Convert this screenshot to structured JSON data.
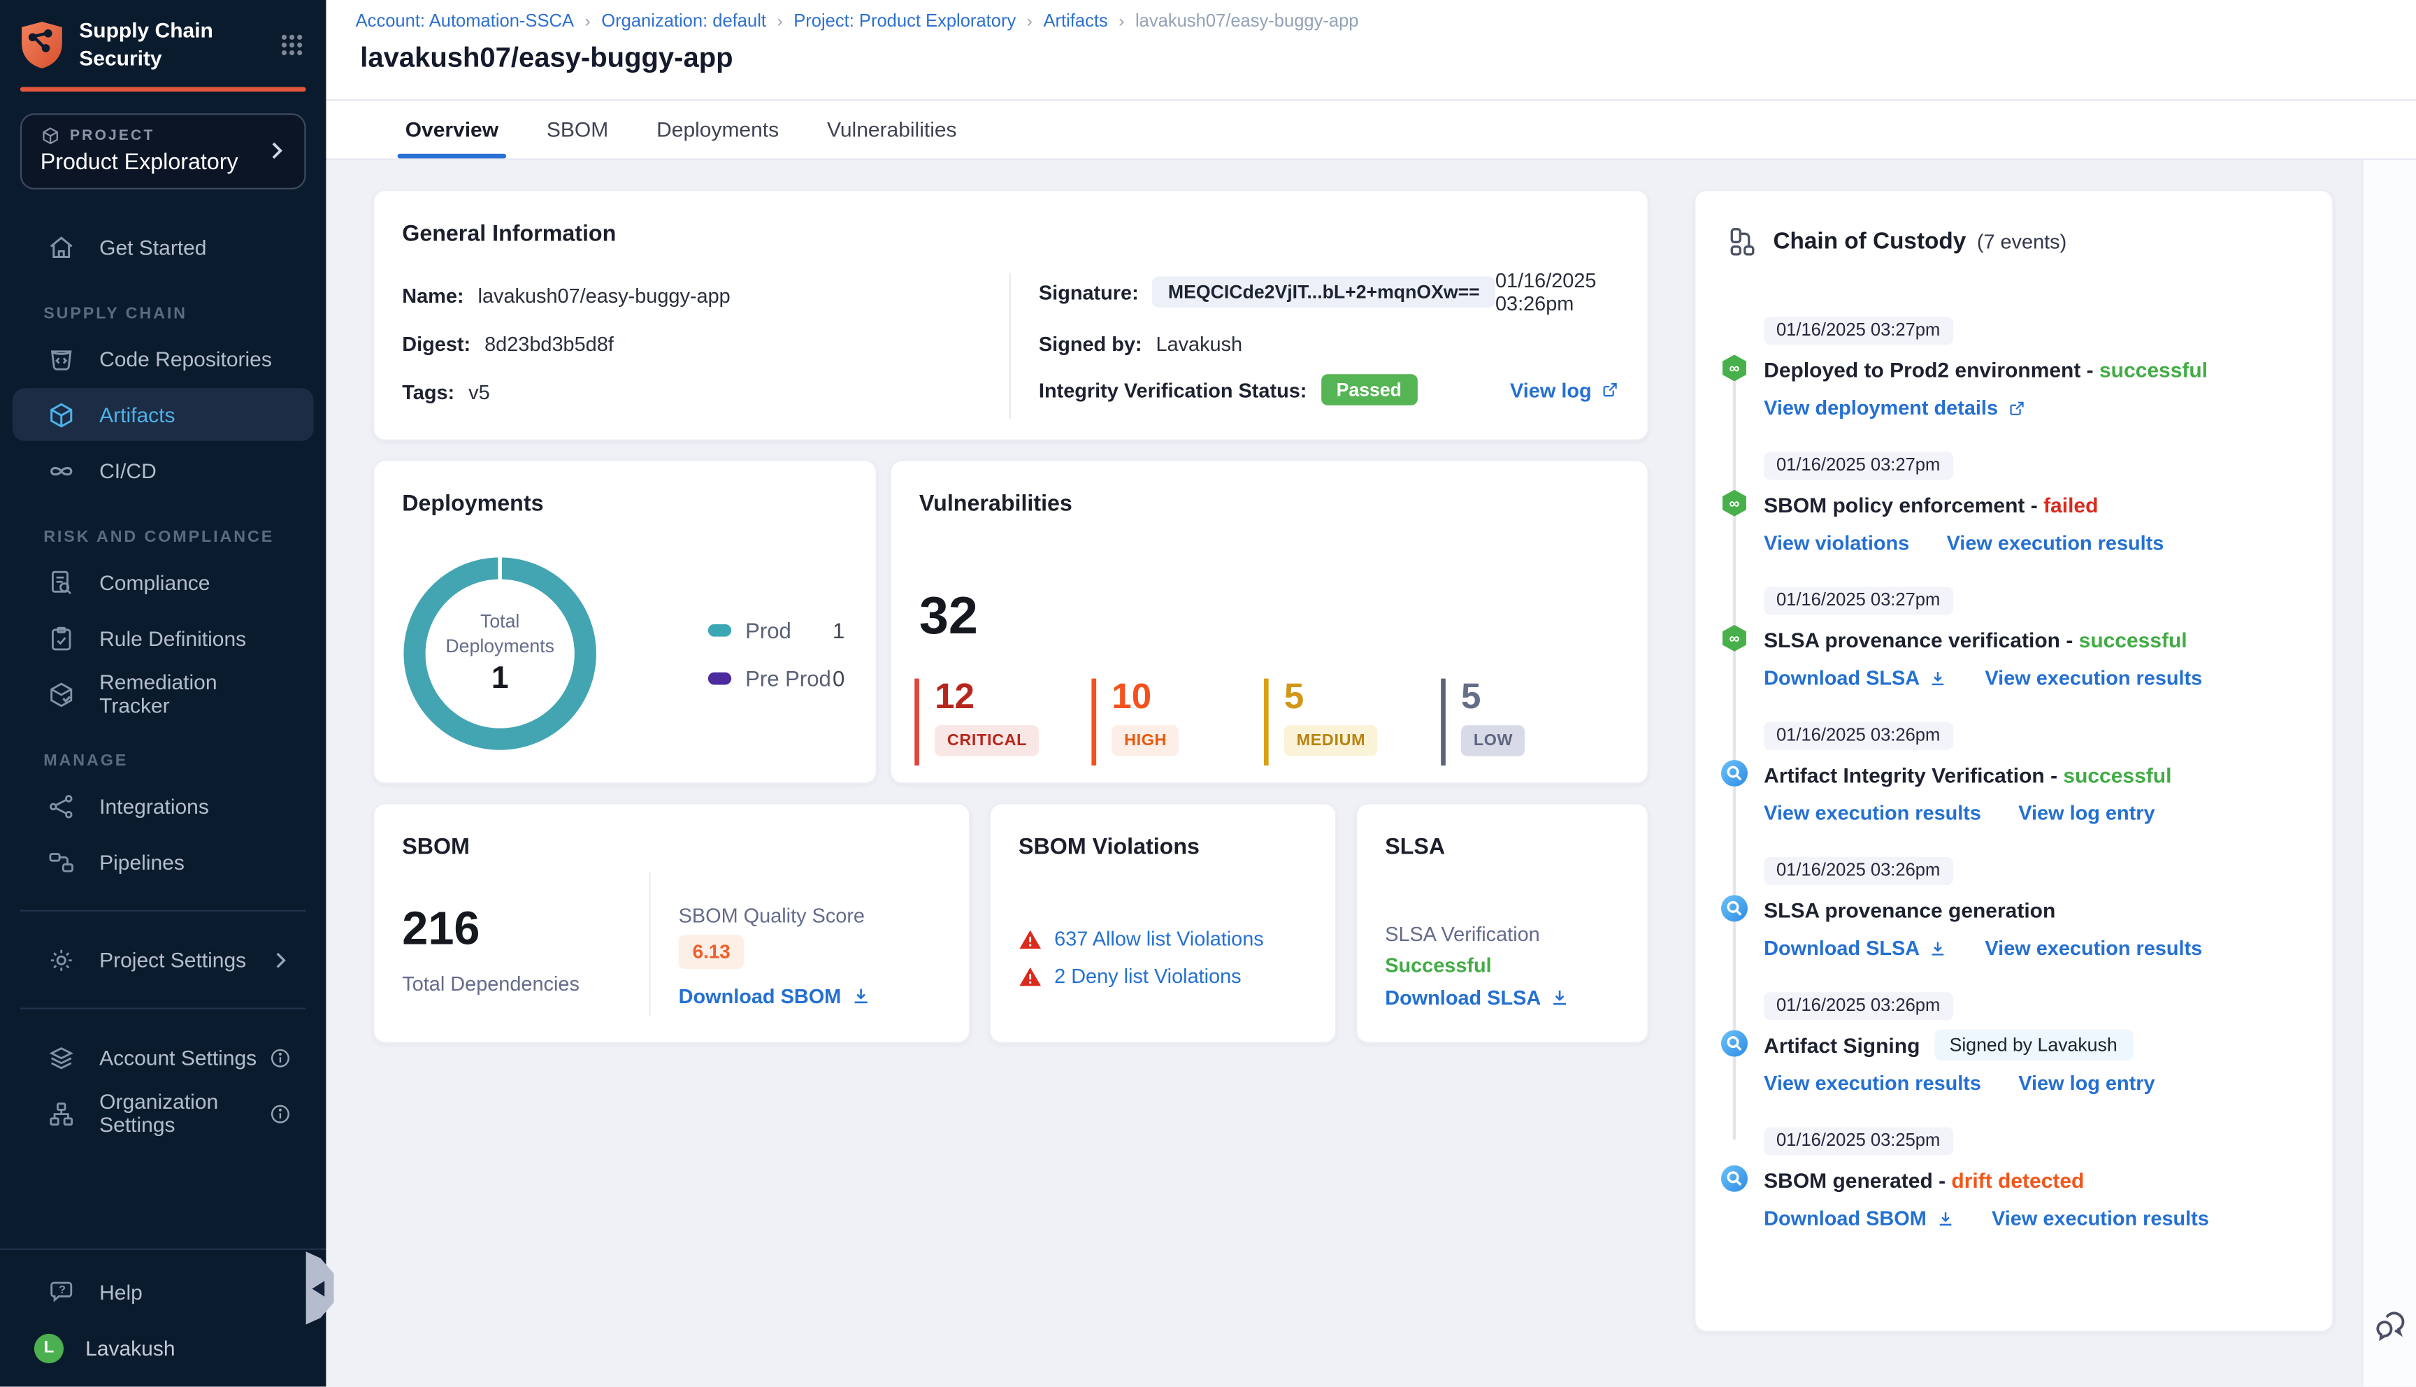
{
  "app": {
    "title_line1": "Supply Chain",
    "title_line2": "Security"
  },
  "breadcrumb": {
    "items": [
      "Account: Automation-SSCA",
      "Organization: default",
      "Project: Product Exploratory",
      "Artifacts",
      "lavakush07/easy-buggy-app"
    ]
  },
  "page": {
    "title": "lavakush07/easy-buggy-app",
    "tabs": [
      "Overview",
      "SBOM",
      "Deployments",
      "Vulnerabilities"
    ],
    "active_tab": "Overview"
  },
  "sidebar": {
    "project": {
      "label": "PROJECT",
      "name": "Product Exploratory"
    },
    "get_started": "Get Started",
    "sections": [
      {
        "heading": "SUPPLY CHAIN",
        "items": [
          "Code Repositories",
          "Artifacts",
          "CI/CD"
        ]
      },
      {
        "heading": "RISK AND COMPLIANCE",
        "items": [
          "Compliance",
          "Rule Definitions",
          "Remediation Tracker"
        ]
      },
      {
        "heading": "MANAGE",
        "items": [
          "Integrations",
          "Pipelines"
        ]
      }
    ],
    "project_settings": "Project Settings",
    "account_settings": "Account Settings",
    "organization_settings": "Organization Settings",
    "help": "Help",
    "user": {
      "name": "Lavakush",
      "initial": "L"
    }
  },
  "general_info": {
    "title": "General Information",
    "name_label": "Name:",
    "name": "lavakush07/easy-buggy-app",
    "digest_label": "Digest:",
    "digest": "8d23bd3b5d8f",
    "tags_label": "Tags:",
    "tags": "v5",
    "signature_label": "Signature:",
    "signature": "MEQCICde2VjIT...bL+2+mqnOXw==",
    "signature_date": "01/16/2025 03:26pm",
    "signed_by_label": "Signed by:",
    "signed_by": "Lavakush",
    "integrity_label": "Integrity Verification Status:",
    "integrity_status": "Passed",
    "view_log": "View log"
  },
  "deployments": {
    "title": "Deployments",
    "center_label_1": "Total",
    "center_label_2": "Deployments",
    "total": "1",
    "legend": [
      {
        "label": "Prod",
        "value": "1",
        "color": "#3ba7b3"
      },
      {
        "label": "Pre Prod",
        "value": "0",
        "color": "#4b2b9e"
      }
    ]
  },
  "vulnerabilities": {
    "title": "Vulnerabilities",
    "total": "32",
    "severities": [
      {
        "count": "12",
        "label": "CRITICAL"
      },
      {
        "count": "10",
        "label": "HIGH"
      },
      {
        "count": "5",
        "label": "MEDIUM"
      },
      {
        "count": "5",
        "label": "LOW"
      }
    ]
  },
  "sbom": {
    "title": "SBOM",
    "total": "216",
    "total_label": "Total Dependencies",
    "quality_label": "SBOM Quality Score",
    "quality_score": "6.13",
    "download": "Download SBOM"
  },
  "sbom_violations": {
    "title": "SBOM Violations",
    "allow": "637 Allow list Violations",
    "deny": "2 Deny list Violations"
  },
  "slsa": {
    "title": "SLSA",
    "verification_label": "SLSA Verification",
    "status": "Successful",
    "download": "Download SLSA"
  },
  "chain_of_custody": {
    "title": "Chain of Custody",
    "events_count": "(7 events)",
    "events": [
      {
        "time": "01/16/2025 03:27pm",
        "title": "Deployed to Prod2 environment",
        "sep": " - ",
        "status": "successful",
        "links": [
          "View deployment details"
        ]
      },
      {
        "time": "01/16/2025 03:27pm",
        "title": "SBOM policy enforcement",
        "sep": " - ",
        "status": "failed",
        "links": [
          "View violations",
          "View execution results"
        ]
      },
      {
        "time": "01/16/2025 03:27pm",
        "title": "SLSA provenance verification",
        "sep": " - ",
        "status": "successful",
        "links": [
          "Download SLSA",
          "View execution results"
        ]
      },
      {
        "time": "01/16/2025 03:26pm",
        "title": "Artifact Integrity Verification",
        "sep": " - ",
        "status": "successful",
        "links": [
          "View execution results",
          "View log entry"
        ]
      },
      {
        "time": "01/16/2025 03:26pm",
        "title": "SLSA provenance generation",
        "links": [
          "Download SLSA",
          "View execution results"
        ]
      },
      {
        "time": "01/16/2025 03:26pm",
        "title": "Artifact Signing",
        "badge": "Signed by Lavakush",
        "links": [
          "View execution results",
          "View log entry"
        ]
      },
      {
        "time": "01/16/2025 03:25pm",
        "title": "SBOM generated",
        "sep": " - ",
        "status": "drift detected",
        "links": [
          "Download SBOM",
          "View execution results"
        ]
      }
    ]
  }
}
